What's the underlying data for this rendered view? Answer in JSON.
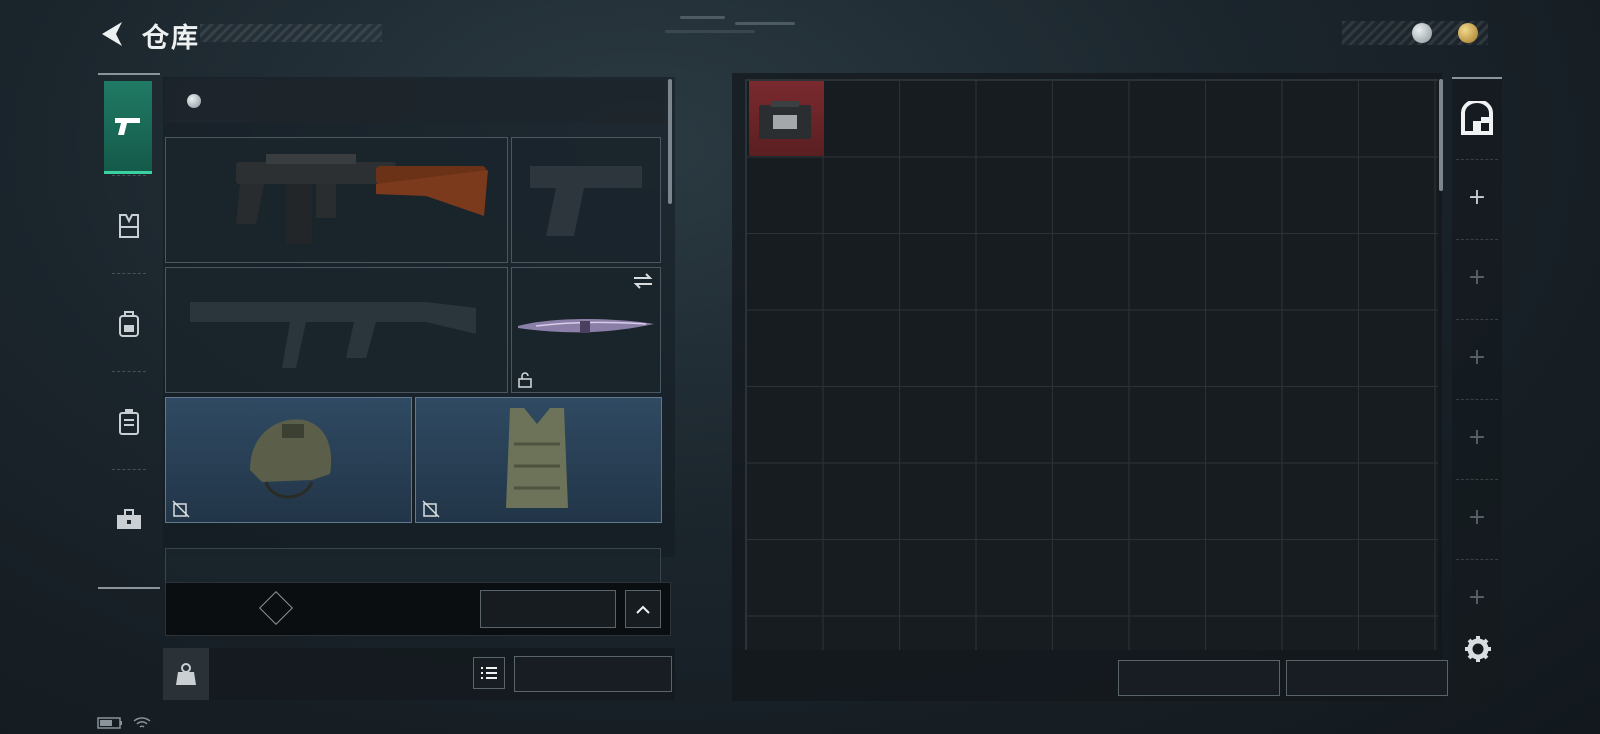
{
  "header": {
    "title": "仓库"
  },
  "currency": {
    "silver": {
      "value": "",
      "icon": "silver-coin-icon",
      "color": "#c9cfd3"
    },
    "gold": {
      "value": "",
      "icon": "gold-coin-icon",
      "color": "#c9a44a"
    }
  },
  "tabs": [
    {
      "icon": "pistol-icon",
      "active": true
    },
    {
      "icon": "vest-icon"
    },
    {
      "icon": "backpack-icon"
    },
    {
      "icon": "case-icon"
    },
    {
      "icon": "toolbox-icon"
    }
  ],
  "loadout": {
    "value_label": "",
    "value": "",
    "primary": {
      "name": "",
      "caliber": "",
      "ammo": ""
    },
    "melee": {
      "name": ""
    },
    "helmet": {
      "name": "",
      "brand": "",
      "durability": ""
    },
    "armor": {
      "name": "",
      "brand": "",
      "durability": ""
    },
    "chest_rig": {
      "label": ""
    }
  },
  "keycard": {
    "label": "",
    "help": "",
    "manage_button": ""
  },
  "bottom": {
    "weight": "",
    "weight_max": "",
    "transfer_all_button": ""
  },
  "storage": {
    "items": [
      {
        "name": "",
        "count": ""
      }
    ],
    "sort_button": "",
    "sell_button": ""
  },
  "status_bar": {
    "ping": "",
    "uid": ""
  },
  "colors": {
    "accent": "#2a8a6e",
    "item_bg": "#6b2528",
    "panel": "#1a2026"
  }
}
